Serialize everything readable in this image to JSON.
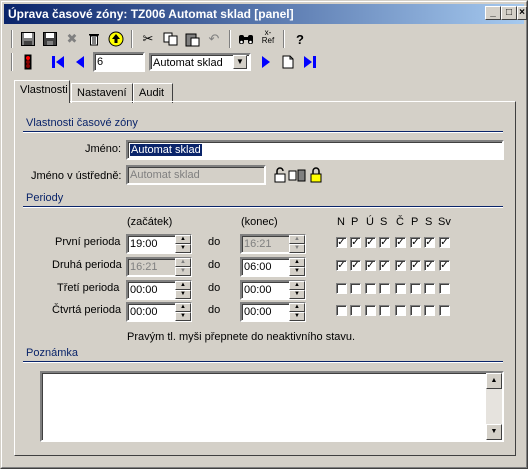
{
  "window": {
    "title": "Úprava časové zóny: TZ006 Automat sklad [panel]"
  },
  "navbar": {
    "record": "6",
    "combo": "Automat sklad"
  },
  "toolbar": {
    "ref_icon": "x-\nRef"
  },
  "tabs": [
    {
      "label": "Vlastnosti"
    },
    {
      "label": "Nastavení"
    },
    {
      "label": "Audit"
    }
  ],
  "props": {
    "section": "Vlastnosti časové zóny",
    "name_label": "Jméno:",
    "name_value": "Automat sklad",
    "central_label": "Jméno v ústředně:",
    "central_value": "Automat sklad"
  },
  "periods": {
    "section": "Periody",
    "start_hdr": "(začátek)",
    "end_hdr": "(konec)",
    "do": "do",
    "days": [
      "N",
      "P",
      "Ú",
      "S",
      "Č",
      "P",
      "S",
      "Sv"
    ],
    "rows": [
      {
        "label": "První perioda",
        "start": "19:00",
        "start_disabled": false,
        "end": "16:21",
        "end_disabled": true,
        "checks": [
          true,
          true,
          true,
          true,
          true,
          true,
          true,
          true
        ]
      },
      {
        "label": "Druhá perioda",
        "start": "16:21",
        "start_disabled": true,
        "end": "06:00",
        "end_disabled": false,
        "checks": [
          true,
          true,
          true,
          true,
          true,
          true,
          true,
          true
        ]
      },
      {
        "label": "Třetí perioda",
        "start": "00:00",
        "start_disabled": false,
        "end": "00:00",
        "end_disabled": false,
        "checks": [
          false,
          false,
          false,
          false,
          false,
          false,
          false,
          false
        ]
      },
      {
        "label": "Čtvrtá perioda",
        "start": "00:00",
        "start_disabled": false,
        "end": "00:00",
        "end_disabled": false,
        "checks": [
          false,
          false,
          false,
          false,
          false,
          false,
          false,
          false
        ]
      }
    ],
    "hint": "Pravým tl. myši přepnete do neaktivního stavu."
  },
  "note": {
    "section": "Poznámka",
    "text": ""
  }
}
